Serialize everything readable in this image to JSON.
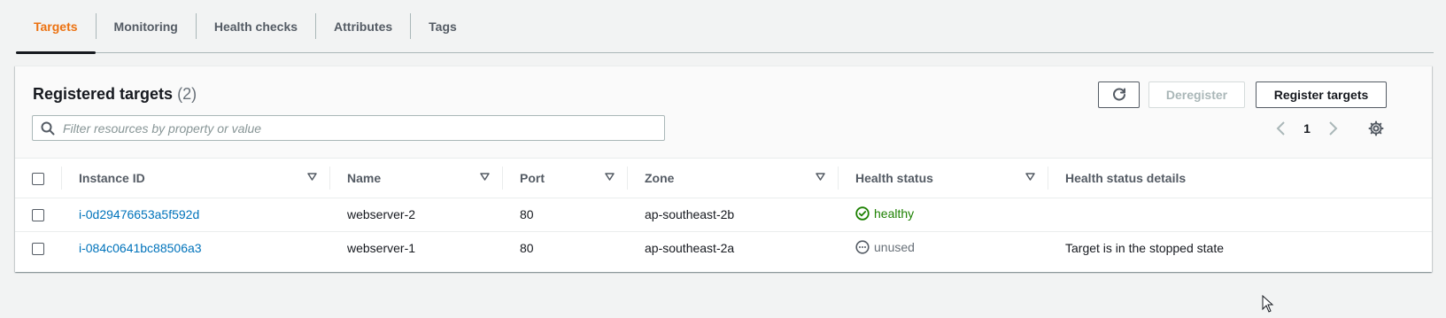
{
  "tabs": [
    {
      "label": "Targets",
      "active": true
    },
    {
      "label": "Monitoring"
    },
    {
      "label": "Health checks"
    },
    {
      "label": "Attributes"
    },
    {
      "label": "Tags"
    }
  ],
  "panel": {
    "title": "Registered targets",
    "count": "(2)",
    "buttons": {
      "refresh_icon": "refresh-icon",
      "deregister": "Deregister",
      "register": "Register targets"
    },
    "search": {
      "placeholder": "Filter resources by property or value",
      "value": ""
    },
    "pagination": {
      "current_page": "1"
    }
  },
  "table": {
    "columns": [
      "Instance ID",
      "Name",
      "Port",
      "Zone",
      "Health status",
      "Health status details"
    ],
    "rows": [
      {
        "instance_id": "i-0d29476653a5f592d",
        "name": "webserver-2",
        "port": "80",
        "zone": "ap-southeast-2b",
        "health_status": "healthy",
        "health_status_details": ""
      },
      {
        "instance_id": "i-084c0641bc88506a3",
        "name": "webserver-1",
        "port": "80",
        "zone": "ap-southeast-2a",
        "health_status": "unused",
        "health_status_details": "Target is in the stopped state"
      }
    ]
  },
  "colors": {
    "accent_tab": "#ec7211",
    "link": "#0073bb",
    "healthy": "#1d8102",
    "unused": "#687078"
  }
}
